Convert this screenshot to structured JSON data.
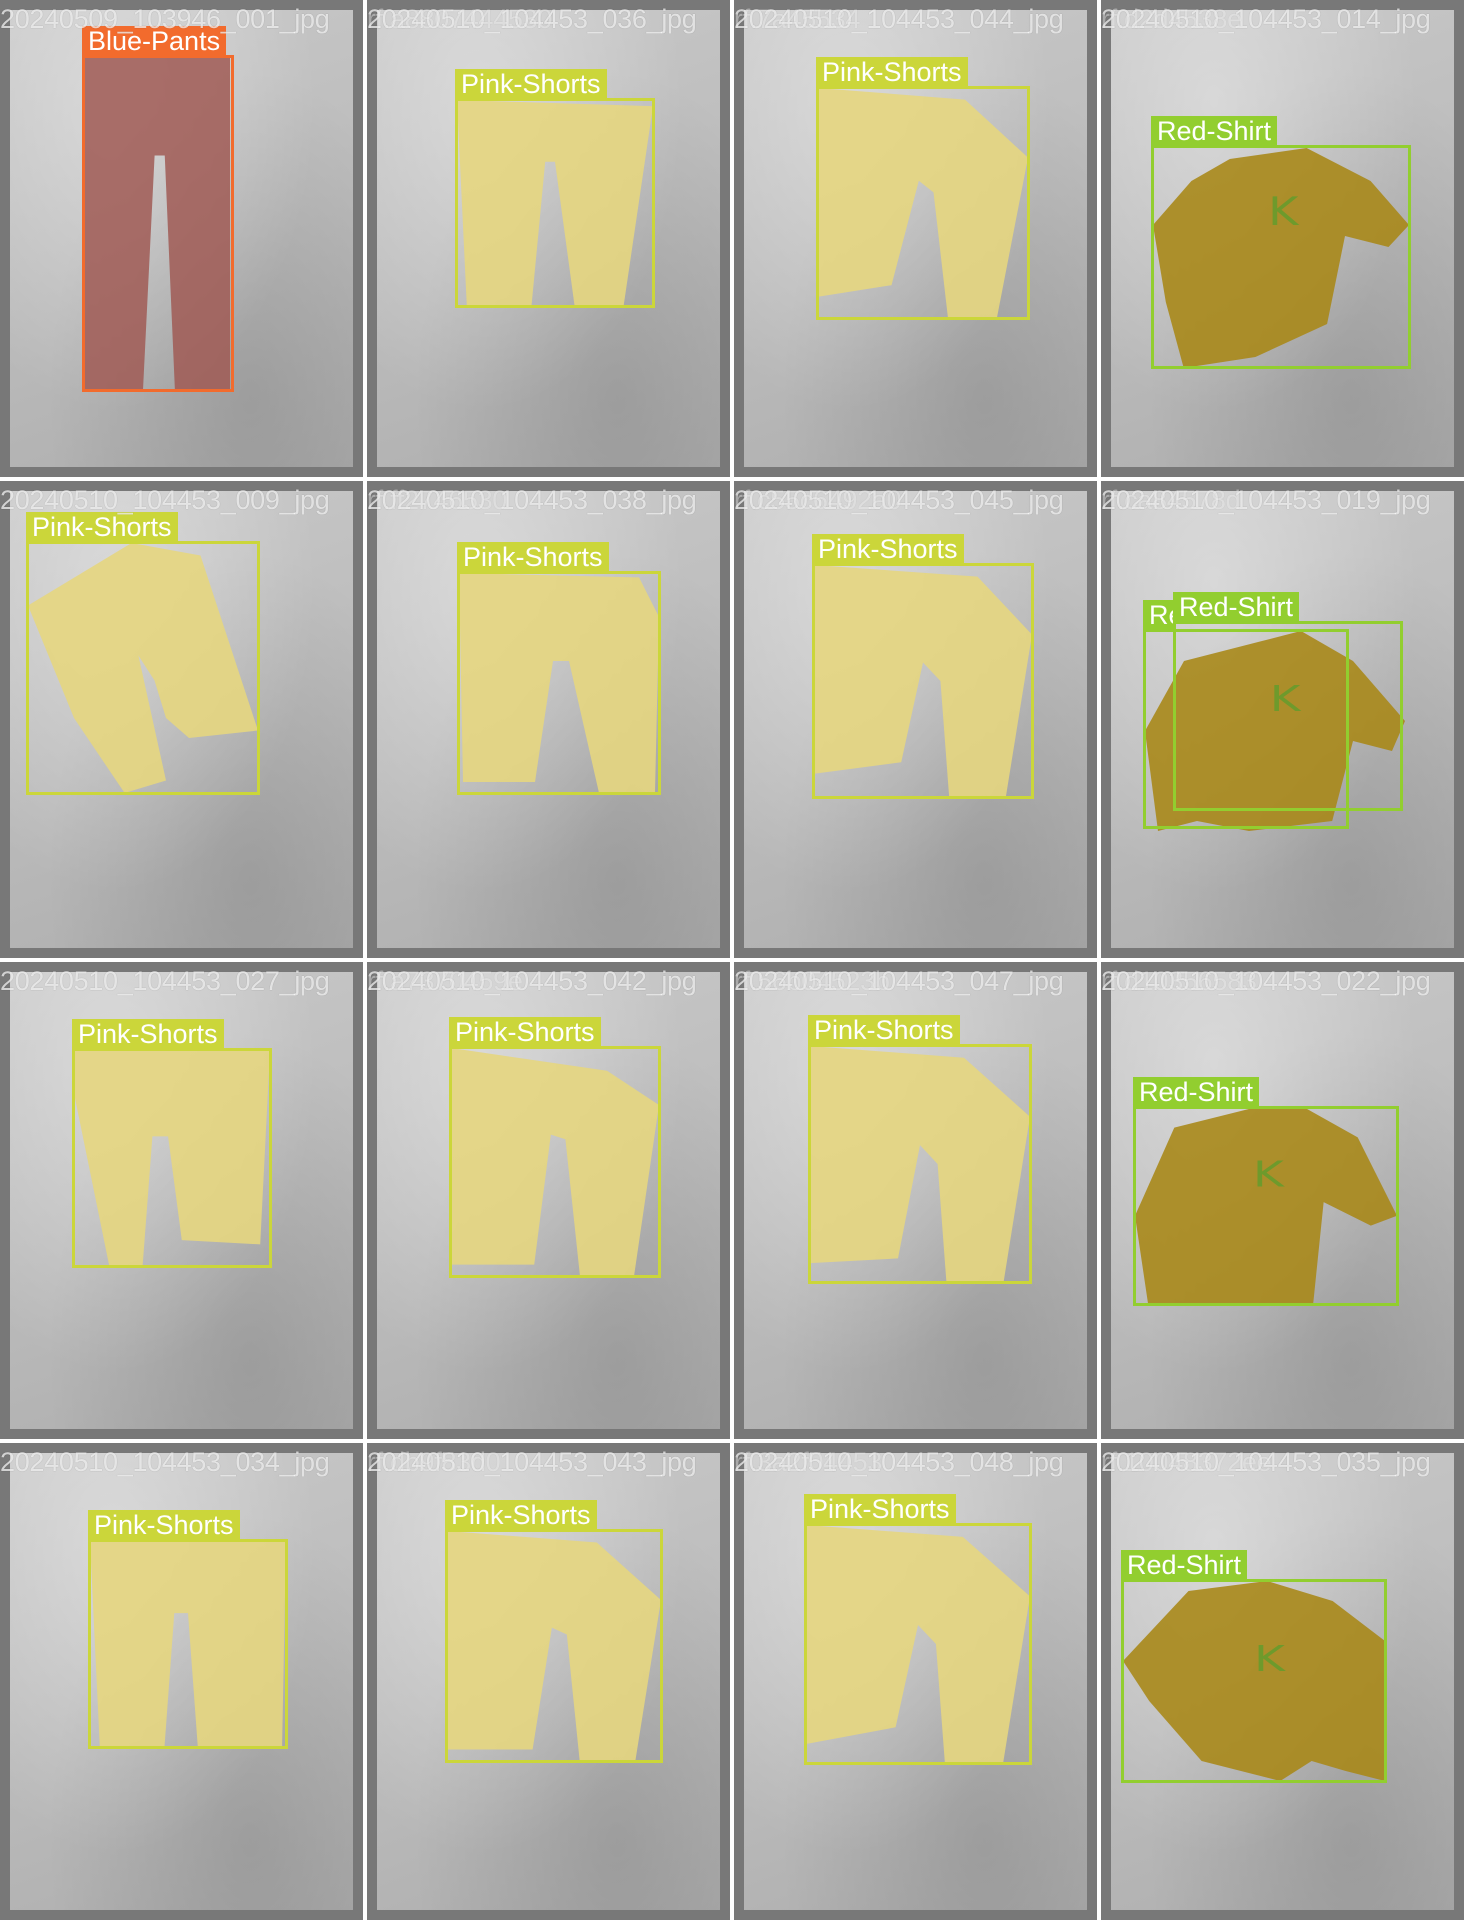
{
  "classes": {
    "pants": {
      "name": "Blue-Pants",
      "color": "#f26b2d",
      "mask_color": "#a05a55"
    },
    "shorts": {
      "name": "Pink-Shorts",
      "color": "#cbd63a",
      "mask_color": "#e6d67f"
    },
    "shirt": {
      "name": "Red-Shirt",
      "color": "#92ce2f",
      "mask_color": "#a8881a"
    }
  },
  "tiles": [
    {
      "filename": "20240509_103946_001_jpg",
      "ghost": "",
      "labels": [
        "Blue-Pants"
      ]
    },
    {
      "filename": "20240510_104453_036_jpg",
      "ghost": "rf.a8807444530",
      "labels": [
        "Pink-Shorts"
      ]
    },
    {
      "filename": "20240510_104453_044_jpg",
      "ghost": "rf.7a45534",
      "labels": [
        "Pink-Shorts"
      ]
    },
    {
      "filename": "20240510_104453_014_jpg",
      "ghost": "rf.d2d4538e",
      "labels": [
        "Red-Shirt"
      ]
    },
    {
      "filename": "20240510_104453_009_jpg",
      "ghost": "",
      "labels": [
        "Pink-Shorts"
      ]
    },
    {
      "filename": "20240510_104453_038_jpg",
      "ghost": "rf.ff2746530",
      "labels": [
        "Pink-Shorts"
      ]
    },
    {
      "filename": "20240510_104453_045_jpg",
      "ghost": "rf.c55c6492a0",
      "labels": [
        "Pink-Shorts"
      ]
    },
    {
      "filename": "20240510_104453_019_jpg",
      "ghost": "rf.ca84578d",
      "labels": [
        "Red-Shirt",
        "Red-Shirt"
      ]
    },
    {
      "filename": "20240510_104453_027_jpg",
      "ghost": "",
      "labels": [
        "Pink-Shorts"
      ]
    },
    {
      "filename": "20240510_104453_042_jpg",
      "ghost": "rf.a7370459e",
      "labels": [
        "Pink-Shorts"
      ]
    },
    {
      "filename": "20240510_104453_047_jpg",
      "ghost": "rf.56b04523b",
      "labels": [
        "Pink-Shorts"
      ]
    },
    {
      "filename": "20240510_104453_022_jpg",
      "ghost": "rf.d10356583",
      "labels": [
        "Red-Shirt"
      ]
    },
    {
      "filename": "20240510_104453_034_jpg",
      "ghost": "",
      "labels": [
        "Pink-Shorts"
      ]
    },
    {
      "filename": "20240510_104453_043_jpg",
      "ghost": "rf.db9f83d0",
      "labels": [
        "Pink-Shorts"
      ]
    },
    {
      "filename": "20240510_104453_048_jpg",
      "ghost": "rf.3a2f04453",
      "labels": [
        "Pink-Shorts"
      ]
    },
    {
      "filename": "20240510_104453_035_jpg",
      "ghost": "rf.10048372ee",
      "labels": [
        "Red-Shirt"
      ]
    }
  ]
}
